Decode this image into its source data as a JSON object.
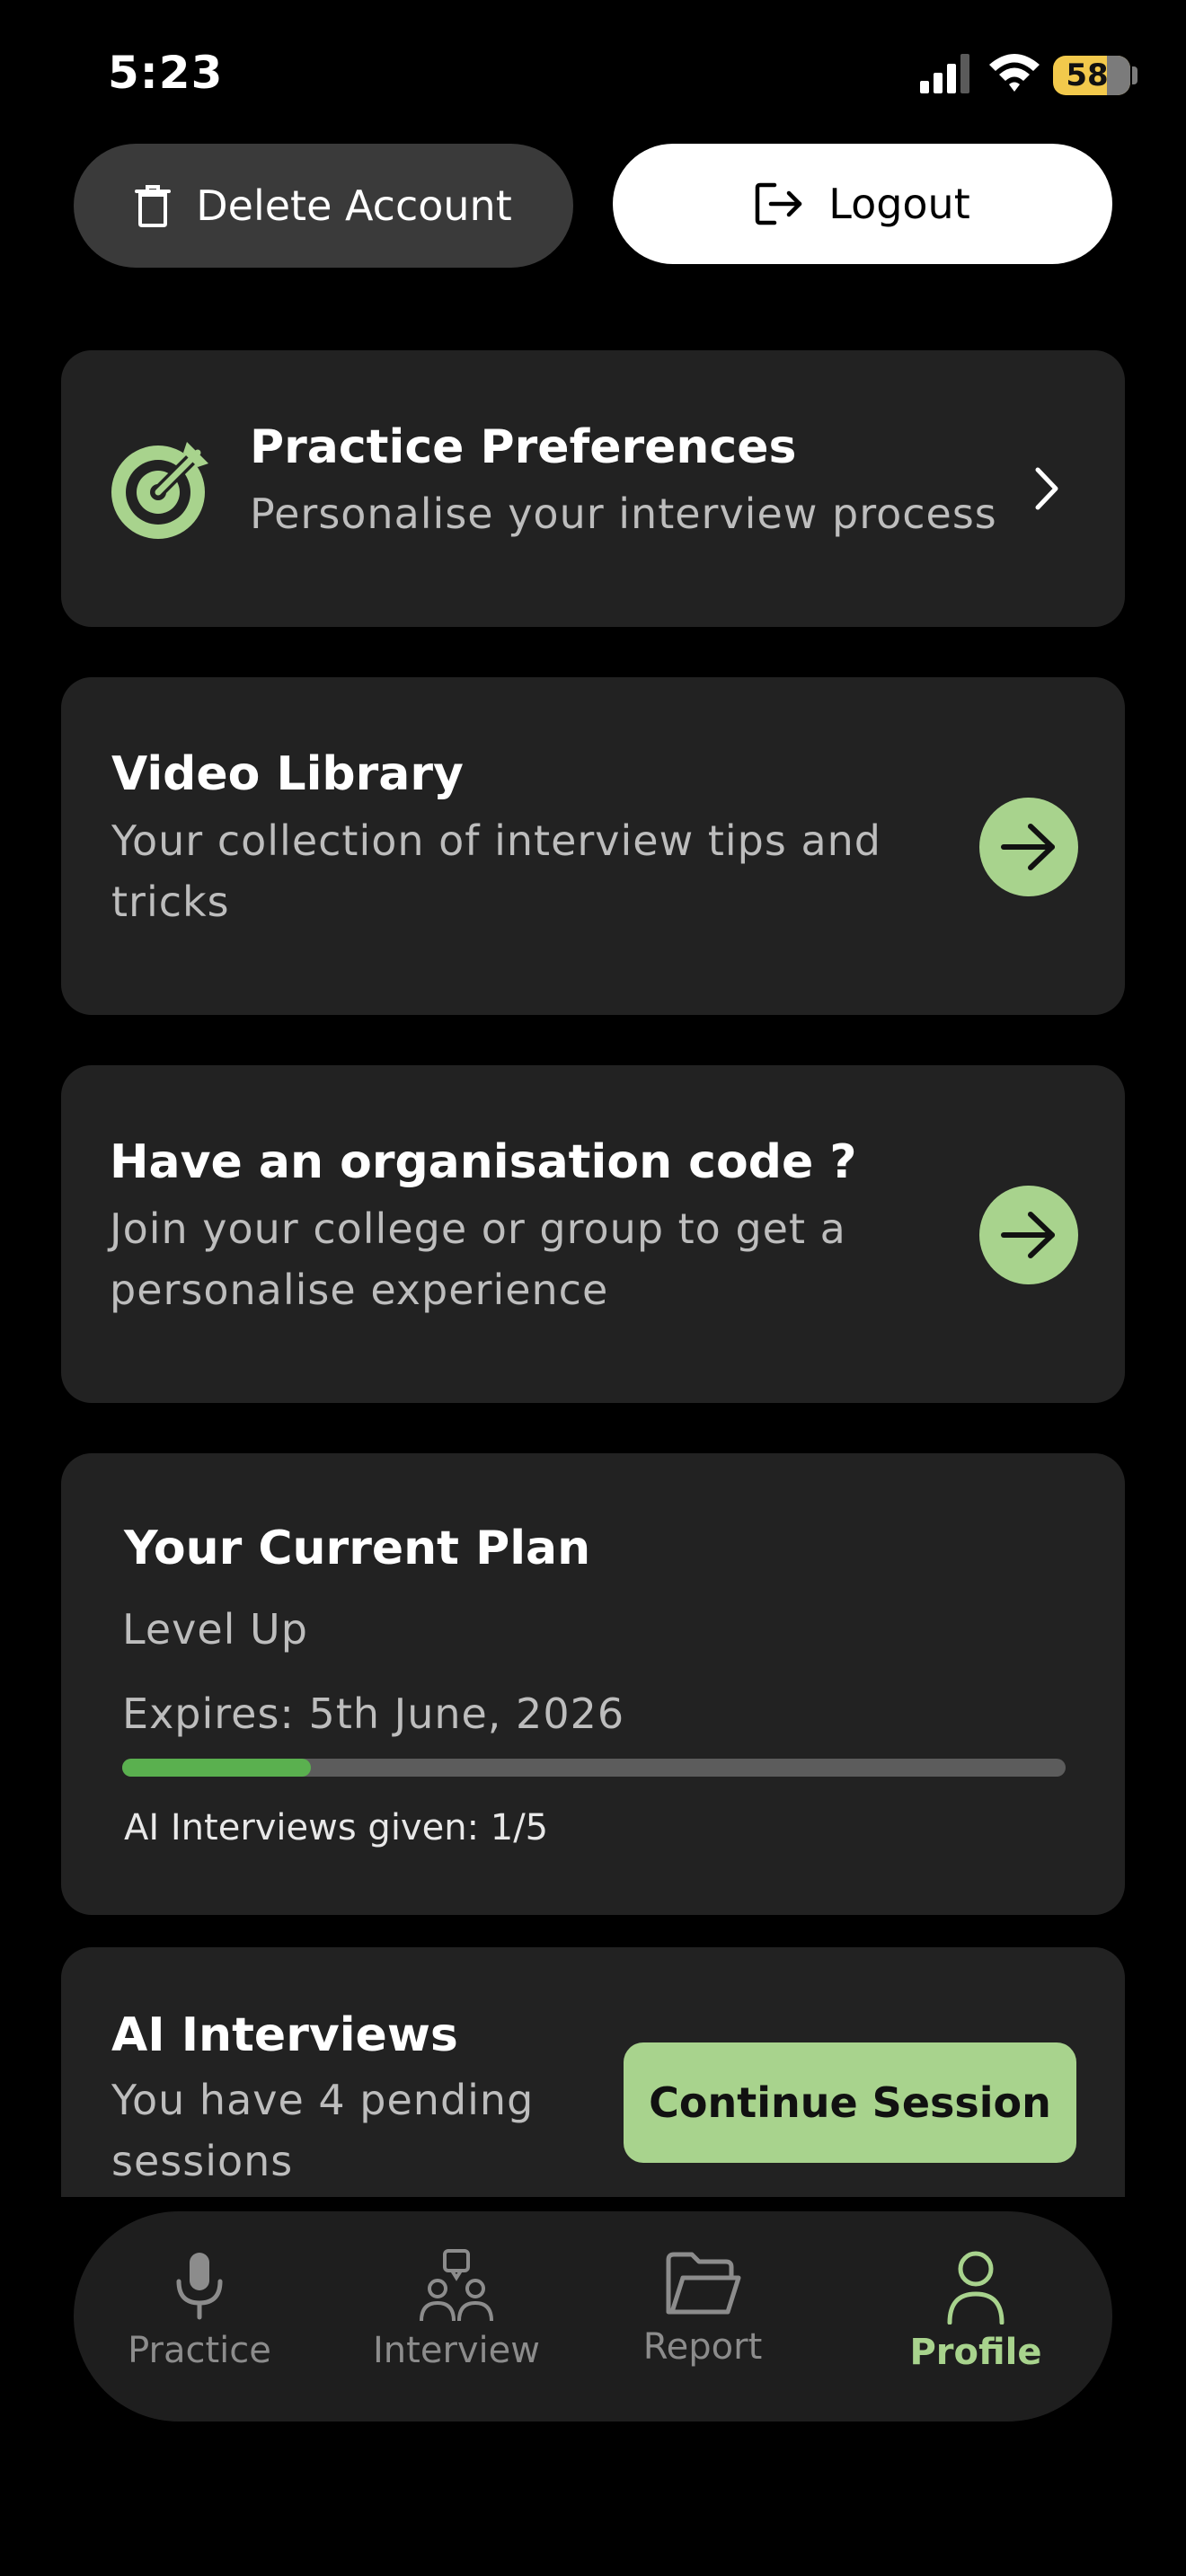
{
  "status_bar": {
    "time": "5:23",
    "battery": "58"
  },
  "actions": {
    "delete_label": "Delete Account",
    "logout_label": "Logout"
  },
  "practice_preferences": {
    "title": "Practice Preferences",
    "subtitle": "Personalise your interview process"
  },
  "video_library": {
    "title": "Video Library",
    "subtitle": "Your collection of interview tips and tricks"
  },
  "organisation": {
    "title": "Have an organisation code ?",
    "subtitle": "Join your college or group to get a personalise experience"
  },
  "plan": {
    "title": "Your Current Plan",
    "name": "Level Up",
    "expires": "Expires: 5th June, 2026",
    "interviews_text": "AI Interviews given: 1/5",
    "progress_fraction": 0.2
  },
  "ai_interviews": {
    "title": "AI Interviews",
    "subtitle": "You have 4 pending sessions",
    "button_label": "Continue Session"
  },
  "nav": {
    "items": [
      {
        "label": "Practice",
        "icon": "microphone-icon"
      },
      {
        "label": "Interview",
        "icon": "people-icon"
      },
      {
        "label": "Report",
        "icon": "folder-icon"
      },
      {
        "label": "Profile",
        "icon": "person-icon"
      }
    ],
    "active": "Profile"
  },
  "colors": {
    "accent": "#a8d38d",
    "progress": "#5ab04f",
    "card": "#222222",
    "battery": "#f2c94c"
  }
}
